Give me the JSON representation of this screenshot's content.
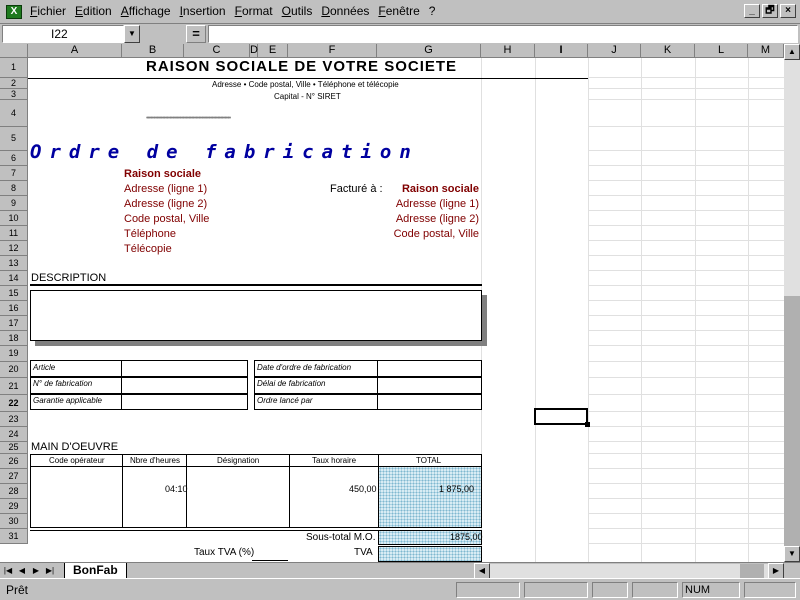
{
  "menu": [
    "Fichier",
    "Edition",
    "Affichage",
    "Insertion",
    "Format",
    "Outils",
    "Données",
    "Fenêtre",
    "?"
  ],
  "app_icon": "excel-icon",
  "window_buttons": [
    "_",
    "🗗",
    "×"
  ],
  "formula_bar": {
    "cell_ref": "I22",
    "equals": "=",
    "value": ""
  },
  "columns": [
    "A",
    "B",
    "C",
    "D",
    "E",
    "F",
    "G",
    "H",
    "I",
    "J",
    "K",
    "L",
    "M"
  ],
  "rows": [
    "1",
    "2",
    "3",
    "4",
    "5",
    "6",
    "7",
    "8",
    "9",
    "10",
    "11",
    "12",
    "13",
    "14",
    "15",
    "16",
    "17",
    "18",
    "19",
    "20",
    "21",
    "22",
    "23",
    "24",
    "25",
    "26",
    "27",
    "28",
    "29",
    "30",
    "31"
  ],
  "doc": {
    "company_title": "RAISON SOCIALE DE VOTRE SOCIETE",
    "company_address": "Adresse • Code postal, Ville • Téléphone et télécopie",
    "company_capital": "Capital - N° SIRET",
    "dots": "••••••••••••••••••••••••••••••••••••••••••••••••••••••••••",
    "form_title": "Ordre de fabrication",
    "left_block": [
      "Raison sociale",
      "Adresse (ligne 1)",
      "Adresse (ligne 2)",
      "Code postal, Ville",
      "Téléphone",
      "Télécopie"
    ],
    "bill_label": "Facturé à :",
    "right_block": [
      "Raison sociale",
      "Adresse (ligne 1)",
      "Adresse (ligne 2)",
      "Code postal, Ville"
    ],
    "description_label": "DESCRIPTION",
    "info_left": [
      "Article",
      "N° de fabrication",
      "Garantie applicable"
    ],
    "info_right": [
      "Date d'ordre de fabrication",
      "Délai de fabrication",
      "Ordre lancé par"
    ],
    "labor_label": "MAIN D'OEUVRE",
    "labor_headers": [
      "Code opérateur",
      "Nbre d'heures",
      "Désignation",
      "Taux horaire",
      "TOTAL"
    ],
    "labor_row": {
      "hours": "04:10",
      "rate": "450,00",
      "total": "1 875,00"
    },
    "subtotal_label": "Sous-total M.O.",
    "subtotal_value": "1875,00",
    "tva_rate_label": "Taux TVA (%)",
    "tva_label": "TVA"
  },
  "sheet_tab": "BonFab",
  "status": {
    "text": "Prêt",
    "num": "NUM"
  }
}
